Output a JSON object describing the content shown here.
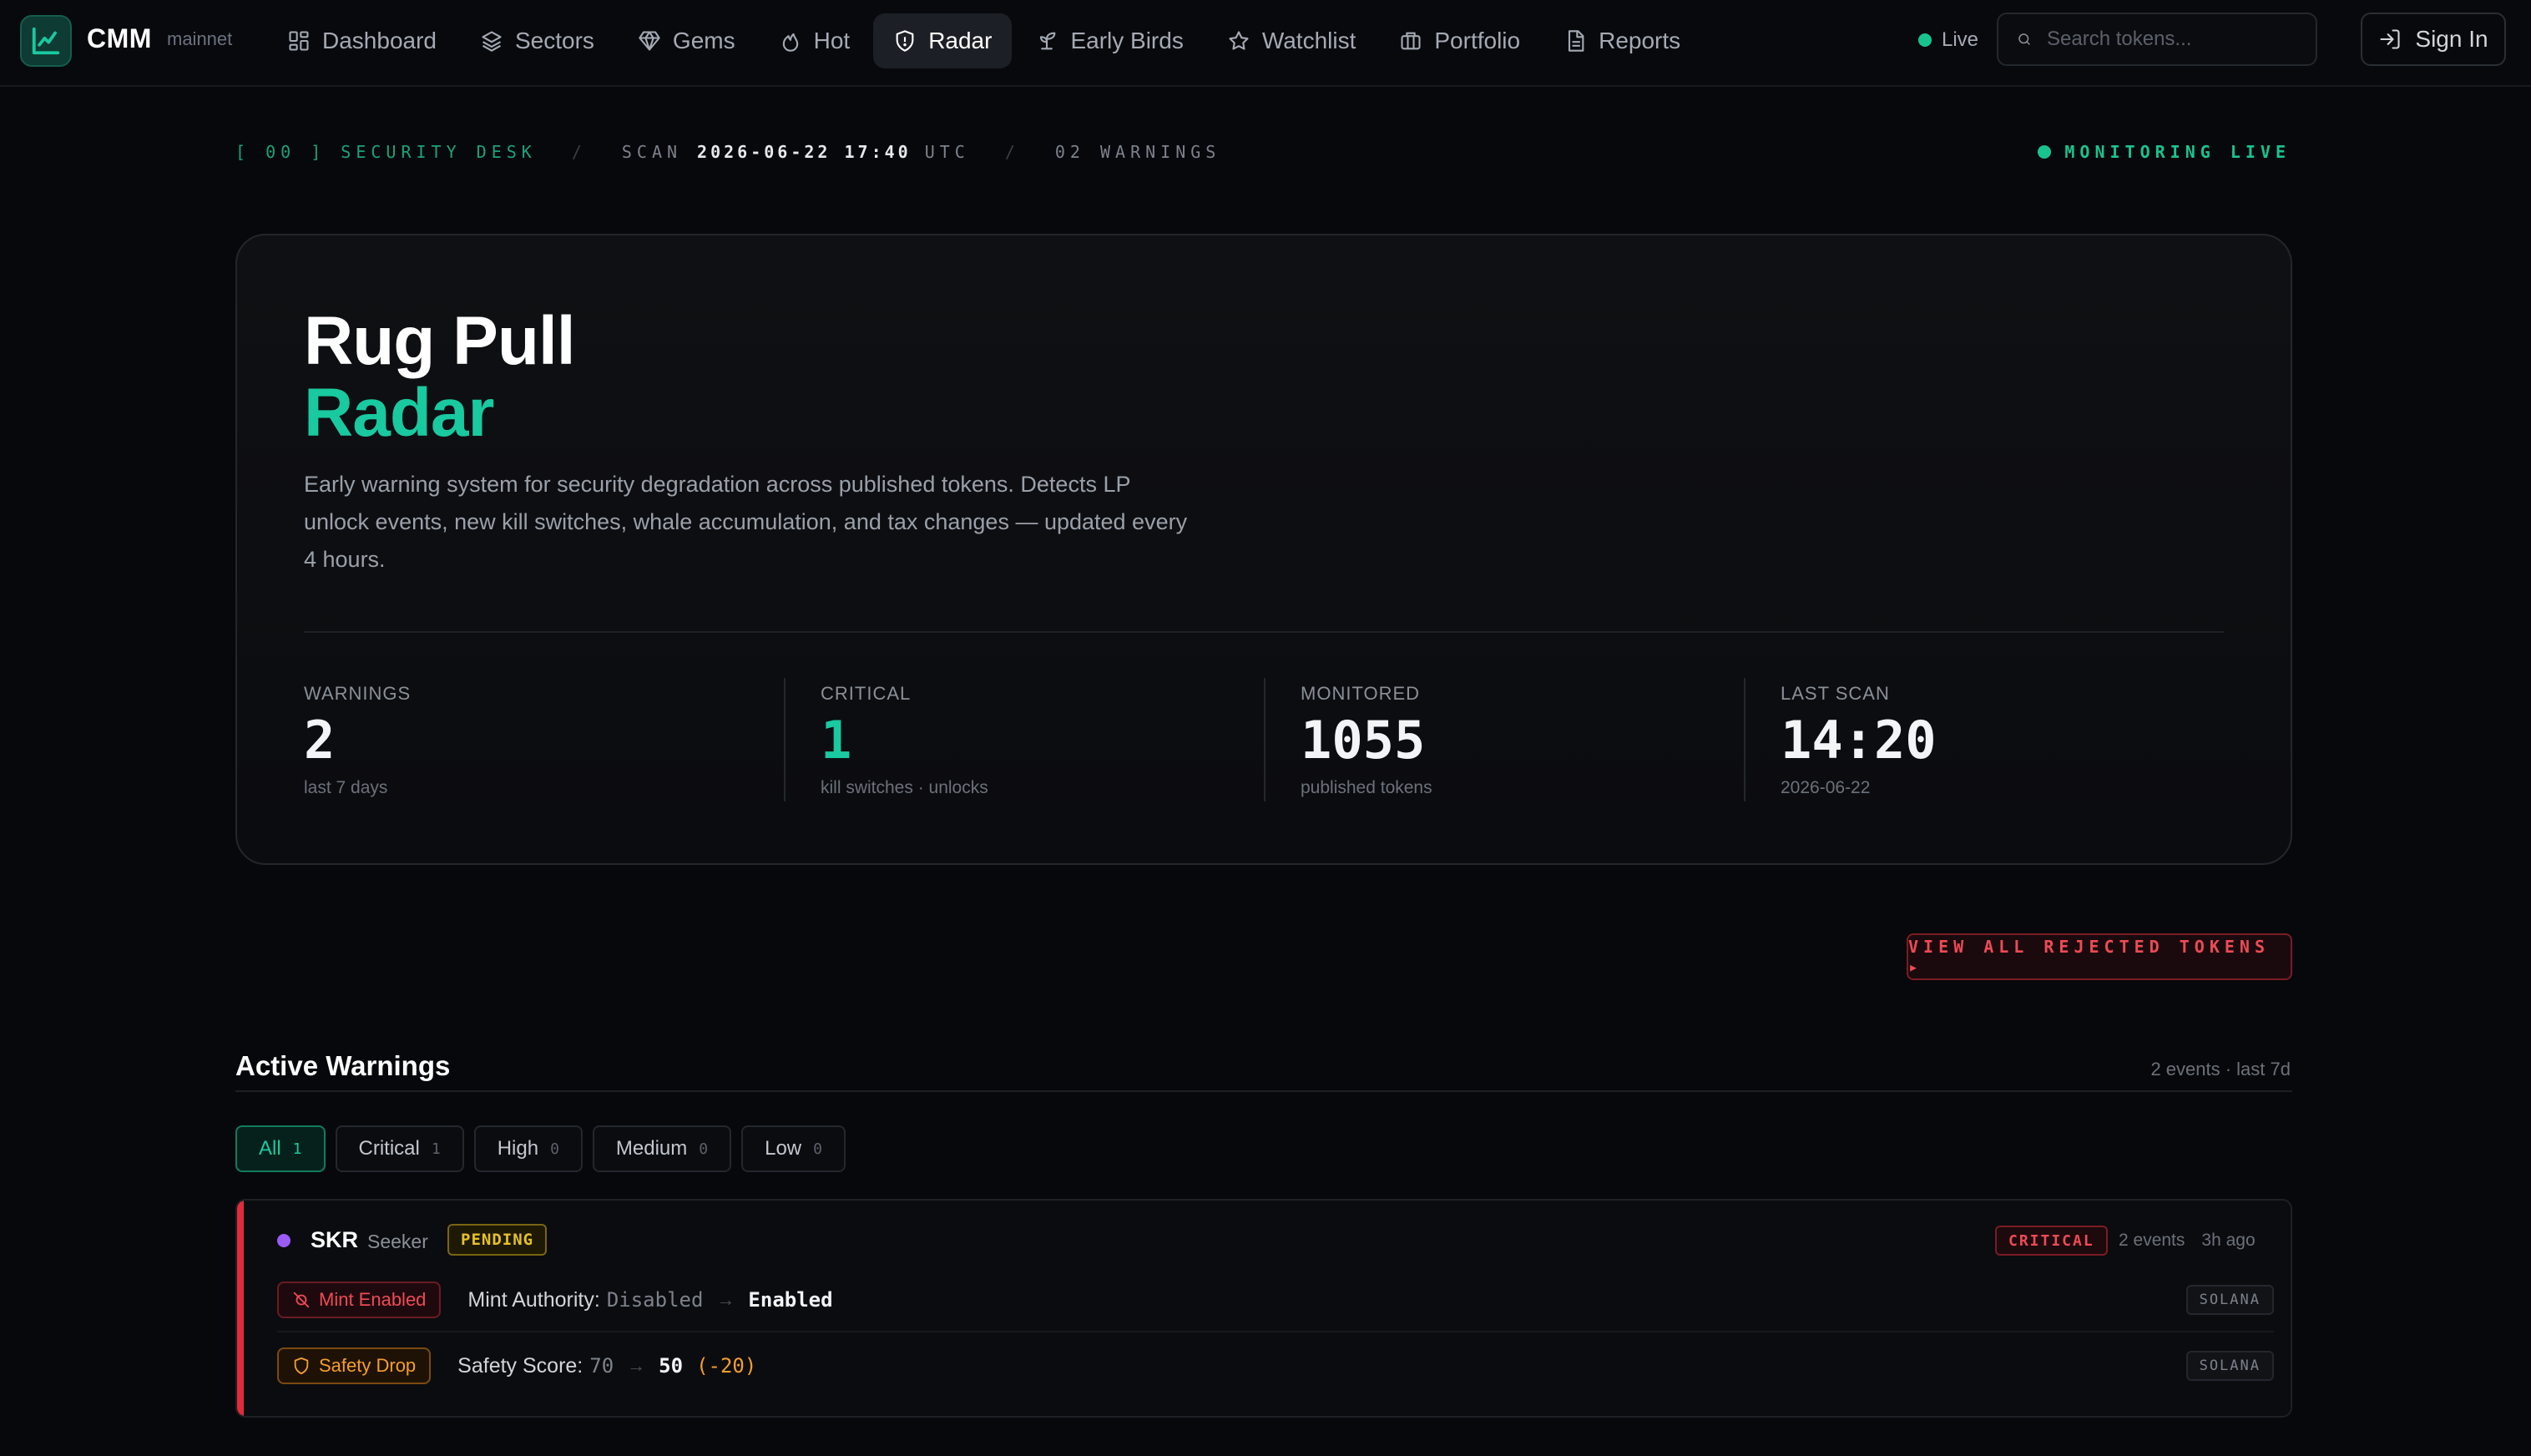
{
  "nav": {
    "brand": "CMM",
    "network": "mainnet",
    "items": [
      {
        "label": "Dashboard",
        "icon": "grid-icon"
      },
      {
        "label": "Sectors",
        "icon": "layers-icon"
      },
      {
        "label": "Gems",
        "icon": "gem-icon"
      },
      {
        "label": "Hot",
        "icon": "flame-icon"
      },
      {
        "label": "Radar",
        "icon": "shield-icon",
        "active": true
      },
      {
        "label": "Early Birds",
        "icon": "sprout-icon"
      },
      {
        "label": "Watchlist",
        "icon": "star-icon"
      },
      {
        "label": "Portfolio",
        "icon": "briefcase-icon"
      },
      {
        "label": "Reports",
        "icon": "document-icon"
      }
    ],
    "live_label": "Live",
    "search_placeholder": "Search tokens...",
    "sign_in": "Sign In"
  },
  "desk": {
    "tag": "[ 00 ] SECURITY DESK",
    "scan_label": "SCAN",
    "scan_time": "2026-06-22 17:40",
    "scan_tz": "UTC",
    "warnings": "02 WARNINGS",
    "monitoring": "MONITORING LIVE"
  },
  "hero": {
    "title_line1": "Rug Pull",
    "title_line2": "Radar",
    "description": "Early warning system for security degradation across published tokens. Detects LP unlock events, new kill switches, whale accumulation, and tax changes — updated every 4 hours.",
    "stats": [
      {
        "label": "WARNINGS",
        "value": "2",
        "sub": "last 7 days"
      },
      {
        "label": "CRITICAL",
        "value": "1",
        "sub": "kill switches · unlocks"
      },
      {
        "label": "MONITORED",
        "value": "1055",
        "sub": "published tokens"
      },
      {
        "label": "LAST SCAN",
        "value": "14:20",
        "sub": "2026-06-22"
      }
    ]
  },
  "rejected_button": "VIEW ALL REJECTED TOKENS ▸",
  "active_warnings": {
    "title": "Active Warnings",
    "meta": "2 events · last 7d",
    "filters": [
      {
        "label": "All",
        "count": "1",
        "active": true
      },
      {
        "label": "Critical",
        "count": "1"
      },
      {
        "label": "High",
        "count": "0"
      },
      {
        "label": "Medium",
        "count": "0"
      },
      {
        "label": "Low",
        "count": "0"
      }
    ],
    "card": {
      "symbol": "SKR",
      "name": "Seeker",
      "status": "PENDING",
      "severity": "CRITICAL",
      "events_count": "2 events",
      "age": "3h ago",
      "dot_color": "#9b5cf6",
      "events": [
        {
          "tag": "Mint Enabled",
          "field": "Mint Authority:",
          "old": "Disabled",
          "arrow": "→",
          "new": "Enabled",
          "delta": "",
          "chain": "SOLANA"
        },
        {
          "tag": "Safety Drop",
          "field": "Safety Score:",
          "old": "70",
          "arrow": "→",
          "new": "50",
          "delta": "(-20)",
          "chain": "SOLANA"
        }
      ]
    }
  },
  "colors": {
    "accent": "#19c9a0",
    "critical": "#ef4a55",
    "warning": "#f59e2a",
    "pending": "#e6c028",
    "background": "#07080b"
  }
}
